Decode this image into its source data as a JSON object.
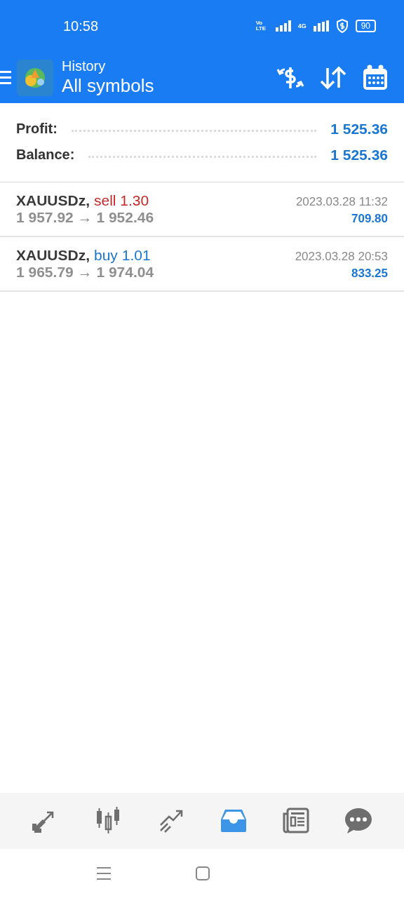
{
  "status_bar": {
    "time": "10:58",
    "volte": "Vo LTE",
    "network": "4G",
    "battery": "90"
  },
  "header": {
    "title": "History",
    "subtitle": "All symbols"
  },
  "summary": [
    {
      "label": "Profit:",
      "value": "1 525.36"
    },
    {
      "label": "Balance:",
      "value": "1 525.36"
    }
  ],
  "deals": [
    {
      "symbol": "XAUUSDz,",
      "side": "sell 1.30",
      "kind": "sell",
      "prices": "1 957.92 → 1 952.46",
      "time": "2023.03.28 11:32",
      "profit": "709.80"
    },
    {
      "symbol": "XAUUSDz,",
      "side": "buy 1.01",
      "kind": "buy",
      "prices": "1 965.79 → 1 974.04",
      "time": "2023.03.28 20:53",
      "profit": "833.25"
    }
  ],
  "bottom_nav": [
    {
      "kind": "quotes",
      "selected": false
    },
    {
      "kind": "chart",
      "selected": false
    },
    {
      "kind": "trade",
      "selected": false
    },
    {
      "kind": "history",
      "selected": true
    },
    {
      "kind": "news",
      "selected": false
    },
    {
      "kind": "chat",
      "selected": false
    }
  ]
}
